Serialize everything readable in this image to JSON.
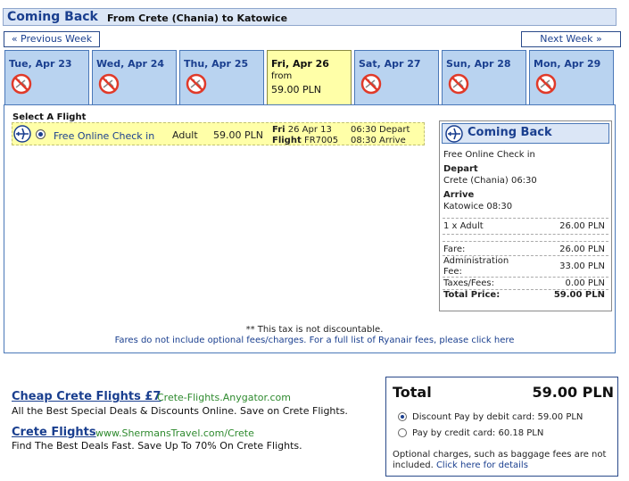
{
  "header": {
    "title": "Coming Back",
    "route": "From Crete (Chania) to Katowice"
  },
  "nav": {
    "prev": "« Previous Week",
    "next": "Next Week »"
  },
  "days": [
    {
      "label": "Tue, Apr 23",
      "available": false
    },
    {
      "label": "Wed, Apr 24",
      "available": false
    },
    {
      "label": "Thu, Apr 25",
      "available": false
    },
    {
      "label": "Fri, Apr 26",
      "available": true,
      "from": "from",
      "price": "59.00 PLN"
    },
    {
      "label": "Sat, Apr 27",
      "available": false
    },
    {
      "label": "Sun, Apr 28",
      "available": false
    },
    {
      "label": "Mon, Apr 29",
      "available": false
    }
  ],
  "select": {
    "title": "Select A Flight",
    "flight": {
      "checkin": "Free Online Check in",
      "passenger": "Adult",
      "price": "59.00 PLN",
      "day": "Fri",
      "date": "26 Apr 13",
      "flight_label": "Flight",
      "flight_no": "FR7005",
      "depart_time": "06:30",
      "depart_label": "Depart",
      "arrive_time": "08:30",
      "arrive_label": "Arrive"
    }
  },
  "summary": {
    "title": "Coming Back",
    "checkin": "Free Online Check in",
    "depart_label": "Depart",
    "depart_value": "Crete (Chania) 06:30",
    "arrive_label": "Arrive",
    "arrive_value": "Katowice 08:30",
    "adult_label": "1 x Adult",
    "adult_value": "26.00 PLN",
    "fare_label": "Fare:",
    "fare_value": "26.00 PLN",
    "admin_label_1": "Administration",
    "admin_label_2": "Fee:",
    "admin_value": "33.00 PLN",
    "taxes_label": "Taxes/Fees:",
    "taxes_value": "0.00 PLN",
    "total_label": "Total Price:",
    "total_value": "59.00 PLN"
  },
  "notes": {
    "tax": "** This tax is not discountable.",
    "fees": "Fares do not include optional fees/charges. For a full list of Ryanair fees, please click here"
  },
  "ads": [
    {
      "title": "Cheap Crete Flights £7",
      "url": "Crete-Flights.Anygator.com",
      "desc": "All the Best Special Deals & Discounts Online. Save on Crete Flights."
    },
    {
      "title": "Crete Flights",
      "url": "www.ShermansTravel.com/Crete",
      "desc": "Find The Best Deals Fast. Save Up To 70% On Crete Flights."
    }
  ],
  "total": {
    "label": "Total",
    "value": "59.00 PLN",
    "debit": "Discount Pay by debit card: 59.00 PLN",
    "credit": "Pay by credit card: 60.18 PLN",
    "optional_1": "Optional charges, such as baggage fees are not",
    "optional_2": "included.",
    "optional_link": "Click here for details"
  },
  "colors": {
    "accent": "#1a3f8f",
    "tab": "#b9d3f0",
    "selected": "#ffffa8",
    "no_flight": "#e03a2a"
  }
}
